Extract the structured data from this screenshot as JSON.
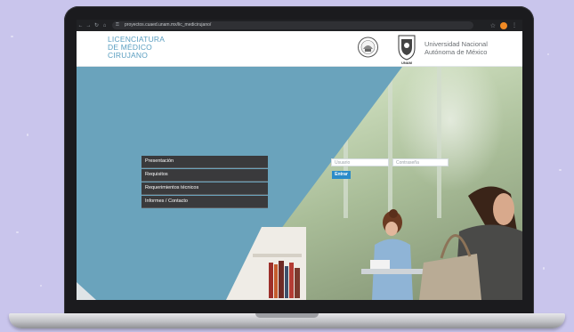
{
  "browser": {
    "url": "proyectos.cuaed.unam.mx/lic_medicirujano/",
    "nav_icons": [
      "back-icon",
      "forward-icon",
      "reload-icon",
      "site-info-icon"
    ]
  },
  "header": {
    "program_line1": "LICENCIATURA",
    "program_line2": "DE MÉDICO",
    "program_line3": "CIRUJANO",
    "unam_label": "UNAM",
    "university_line1": "Universidad Nacional",
    "university_line2": "Autónoma de México"
  },
  "menu": {
    "items": [
      {
        "label": "Presentación"
      },
      {
        "label": "Requisitos"
      },
      {
        "label": "Requerimientos técnicos"
      },
      {
        "label": "Informes / Contacto"
      }
    ]
  },
  "login": {
    "user_placeholder": "Usuario",
    "password_placeholder": "Contraseña",
    "submit_label": "Entrar"
  },
  "colors": {
    "background": "#c9c5ec",
    "brand_blue": "#6aa3bc",
    "menu_dark": "#3a3a3c",
    "button_blue": "#2b8bc9"
  }
}
